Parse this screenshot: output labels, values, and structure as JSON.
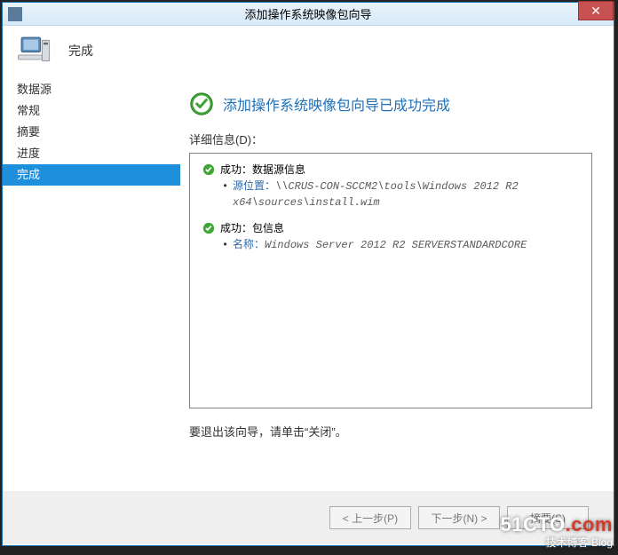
{
  "titlebar": {
    "title": "添加操作系统映像包向导"
  },
  "header": {
    "title": "完成"
  },
  "sidebar": {
    "items": [
      {
        "label": "数据源",
        "active": false
      },
      {
        "label": "常规",
        "active": false
      },
      {
        "label": "摘要",
        "active": false
      },
      {
        "label": "进度",
        "active": false
      },
      {
        "label": "完成",
        "active": true
      }
    ]
  },
  "main": {
    "status_text": "添加操作系统映像包向导已成功完成",
    "detail_label": "详细信息(D)：",
    "items": [
      {
        "success_prefix": "成功：",
        "title": "数据源信息",
        "sub_label": "源位置：",
        "sub_value": "\\\\CRUS-CON-SCCM2\\tools\\Windows 2012 R2 x64\\sources\\install.wim"
      },
      {
        "success_prefix": "成功：",
        "title": "包信息",
        "sub_label": "名称：",
        "sub_value": "Windows Server 2012 R2 SERVERSTANDARDCORE"
      }
    ],
    "exit_text": "要退出该向导，请单击“关闭”。"
  },
  "footer": {
    "prev": "< 上一步(P)",
    "next": "下一步(N) >",
    "summary": "摘要(S)"
  },
  "watermark": {
    "line1a": "51CTO",
    "line1b": ".com",
    "line2": "技术博客    Blog"
  }
}
